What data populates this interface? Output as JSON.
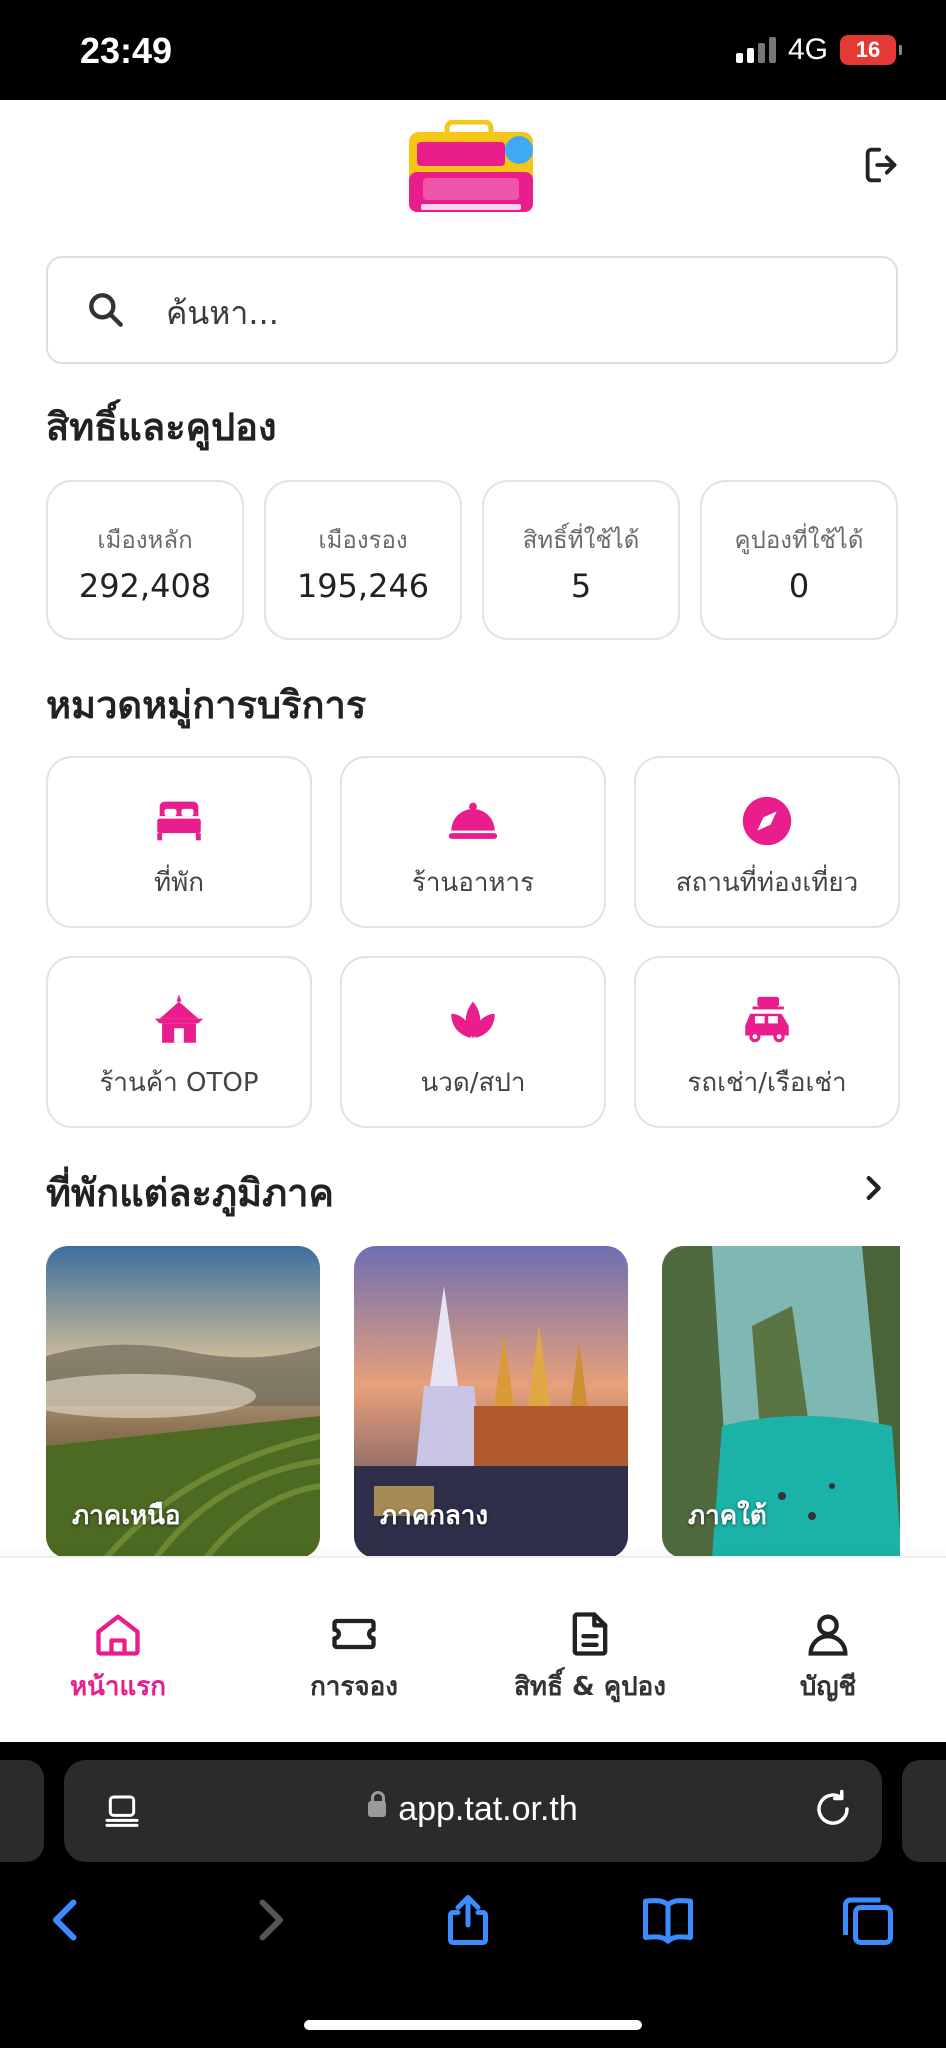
{
  "status_bar": {
    "time": "23:49",
    "network": "4G",
    "battery": "16"
  },
  "search": {
    "placeholder": "ค้นหา..."
  },
  "rights": {
    "title": "สิทธิ์และคูปอง",
    "stats": [
      {
        "label": "เมืองหลัก",
        "value": "292,408"
      },
      {
        "label": "เมืองรอง",
        "value": "195,246"
      },
      {
        "label": "สิทธิ์ที่ใช้ได้",
        "value": "5"
      },
      {
        "label": "คูปองที่ใช้ได้",
        "value": "0"
      }
    ]
  },
  "categories": {
    "title": "หมวดหมู่การบริการ",
    "items": [
      {
        "label": "ที่พัก",
        "icon": "bed-icon"
      },
      {
        "label": "ร้านอาหาร",
        "icon": "food-cloche-icon"
      },
      {
        "label": "สถานที่ท่องเที่ยว",
        "icon": "compass-icon"
      },
      {
        "label": "ร้านค้า OTOP",
        "icon": "thai-pavilion-icon"
      },
      {
        "label": "นวด/สปา",
        "icon": "lotus-icon"
      },
      {
        "label": "รถเช่า/เรือเช่า",
        "icon": "car-luggage-icon"
      }
    ]
  },
  "regions": {
    "title": "ที่พักแต่ละภูมิภาค",
    "items": [
      {
        "label": "ภาคเหนือ"
      },
      {
        "label": "ภาคกลาง"
      },
      {
        "label": "ภาคใต้"
      }
    ]
  },
  "bottom_nav": {
    "items": [
      {
        "label": "หน้าแรก",
        "icon": "home-icon",
        "active": true
      },
      {
        "label": "การจอง",
        "icon": "ticket-icon",
        "active": false
      },
      {
        "label": "สิทธิ์ & คูปอง",
        "icon": "document-icon",
        "active": false
      },
      {
        "label": "บัญชี",
        "icon": "user-icon",
        "active": false
      }
    ]
  },
  "browser": {
    "url": "app.tat.or.th"
  },
  "colors": {
    "accent": "#e91e8c",
    "logo_yellow": "#f5c518"
  }
}
